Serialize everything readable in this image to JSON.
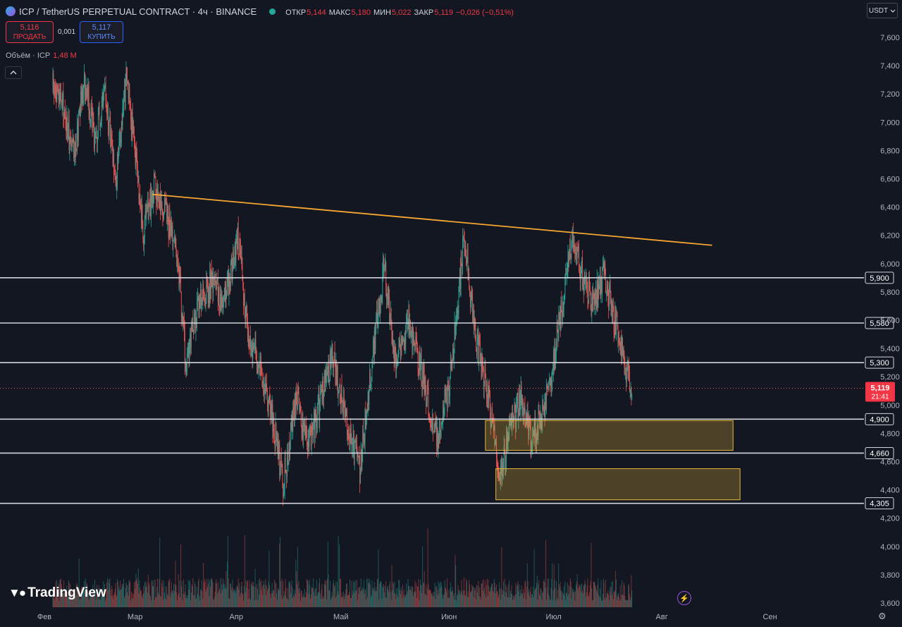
{
  "header": {
    "title": "ICP / TetherUS PERPETUAL CONTRACT · 4ч · BINANCE",
    "ohlc": [
      {
        "label": "ОТКР",
        "value": "5,144"
      },
      {
        "label": "МАКС",
        "value": "5,180"
      },
      {
        "label": "МИН",
        "value": "5,022"
      },
      {
        "label": "ЗАКР",
        "value": "5,119"
      },
      {
        "label": "",
        "value": "−0,026 (−0,51%)"
      }
    ]
  },
  "trade": {
    "sell_price": "5,116",
    "sell_label": "ПРОДАТЬ",
    "spread": "0,001",
    "buy_price": "5,117",
    "buy_label": "КУПИТЬ"
  },
  "volume": {
    "label": "Объём · ICP",
    "value": "1,48 M"
  },
  "currency": "USDT",
  "brand": "TradingView",
  "colors": {
    "up": "#26a69a",
    "down": "#ef5350",
    "trendline": "#f7a630",
    "zone": "#e5b53a",
    "level": "#d1d4dc"
  },
  "chart_data": {
    "type": "candlestick",
    "interval": "4h",
    "y_ticks": [
      3.6,
      3.8,
      4.0,
      4.2,
      4.4,
      4.6,
      4.8,
      5.0,
      5.2,
      5.4,
      5.6,
      5.8,
      6.0,
      6.2,
      6.4,
      6.6,
      6.8,
      7.0,
      7.2,
      7.4,
      7.6
    ],
    "y_tick_labels": [
      "3,600",
      "3,800",
      "4,000",
      "4,200",
      "4,400",
      "4,600",
      "4,800",
      "5,000",
      "5,200",
      "5,400",
      "5,600",
      "5,800",
      "6,000",
      "6,200",
      "6,400",
      "6,600",
      "6,800",
      "7,000",
      "7,200",
      "7,400",
      "7,600"
    ],
    "ylim": [
      3.58,
      7.68
    ],
    "x_ticks": [
      "Фев",
      "Мар",
      "Апр",
      "Май",
      "Июн",
      "Июл",
      "Авг",
      "Сен"
    ],
    "price_path": [
      {
        "d": 0,
        "p": 7.25
      },
      {
        "d": 3,
        "p": 7.1
      },
      {
        "d": 6,
        "p": 6.75
      },
      {
        "d": 9,
        "p": 7.3
      },
      {
        "d": 12,
        "p": 6.9
      },
      {
        "d": 15,
        "p": 7.2
      },
      {
        "d": 18,
        "p": 6.6
      },
      {
        "d": 21,
        "p": 7.3
      },
      {
        "d": 24,
        "p": 6.7
      },
      {
        "d": 26,
        "p": 6.2
      },
      {
        "d": 29,
        "p": 6.55
      },
      {
        "d": 32,
        "p": 6.4
      },
      {
        "d": 36,
        "p": 6.0
      },
      {
        "d": 38,
        "p": 5.3
      },
      {
        "d": 42,
        "p": 5.7
      },
      {
        "d": 46,
        "p": 5.9
      },
      {
        "d": 49,
        "p": 5.7
      },
      {
        "d": 53,
        "p": 6.2
      },
      {
        "d": 56,
        "p": 5.5
      },
      {
        "d": 59,
        "p": 5.3
      },
      {
        "d": 63,
        "p": 4.9
      },
      {
        "d": 66,
        "p": 4.45
      },
      {
        "d": 70,
        "p": 5.05
      },
      {
        "d": 73,
        "p": 4.7
      },
      {
        "d": 77,
        "p": 5.05
      },
      {
        "d": 80,
        "p": 5.35
      },
      {
        "d": 84,
        "p": 4.9
      },
      {
        "d": 88,
        "p": 4.55
      },
      {
        "d": 92,
        "p": 5.4
      },
      {
        "d": 95,
        "p": 6.0
      },
      {
        "d": 98,
        "p": 5.3
      },
      {
        "d": 102,
        "p": 5.6
      },
      {
        "d": 106,
        "p": 5.2
      },
      {
        "d": 110,
        "p": 4.75
      },
      {
        "d": 114,
        "p": 5.2
      },
      {
        "d": 118,
        "p": 6.2
      },
      {
        "d": 121,
        "p": 5.5
      },
      {
        "d": 125,
        "p": 5.05
      },
      {
        "d": 128,
        "p": 4.45
      },
      {
        "d": 131,
        "p": 4.8
      },
      {
        "d": 134,
        "p": 5.05
      },
      {
        "d": 137,
        "p": 4.75
      },
      {
        "d": 140,
        "p": 4.9
      },
      {
        "d": 143,
        "p": 5.25
      },
      {
        "d": 146,
        "p": 5.7
      },
      {
        "d": 149,
        "p": 6.2
      },
      {
        "d": 152,
        "p": 5.9
      },
      {
        "d": 155,
        "p": 5.7
      },
      {
        "d": 158,
        "p": 5.95
      },
      {
        "d": 161,
        "p": 5.6
      },
      {
        "d": 164,
        "p": 5.3
      },
      {
        "d": 166,
        "p": 5.1
      }
    ],
    "volume_ylim": [
      0,
      130
    ],
    "trendline": {
      "from": {
        "d": 28.5,
        "p": 6.49
      },
      "to": {
        "d": 189,
        "p": 6.13
      }
    },
    "levels": [
      {
        "price": 5.9,
        "label": "5,900"
      },
      {
        "price": 5.58,
        "label": "5,580"
      },
      {
        "price": 5.3,
        "label": "5,300"
      },
      {
        "price": 4.9,
        "label": "4,900"
      },
      {
        "price": 4.66,
        "label": "4,660"
      },
      {
        "price": 4.305,
        "label": "4,305"
      }
    ],
    "zones": [
      {
        "d_from": 124,
        "d_to": 195,
        "p_low": 4.68,
        "p_high": 4.89
      },
      {
        "d_from": 127,
        "d_to": 197,
        "p_low": 4.33,
        "p_high": 4.55
      }
    ],
    "current_price": {
      "price": 5.119,
      "label": "5,119",
      "countdown": "21:41"
    }
  }
}
